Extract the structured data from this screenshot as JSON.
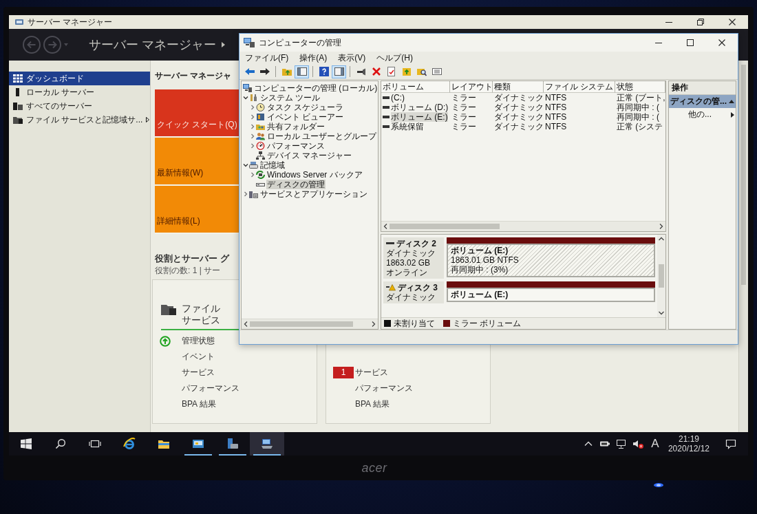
{
  "monitor": {
    "logo": "acer"
  },
  "server_manager": {
    "window_title": "サーバー マネージャー",
    "header_title": "サーバー マネージャー",
    "nav": [
      {
        "label": "ダッシュボード",
        "selected": true,
        "submenu": false
      },
      {
        "label": "ローカル サーバー",
        "selected": false,
        "submenu": false
      },
      {
        "label": "すべてのサーバー",
        "selected": false,
        "submenu": false
      },
      {
        "label": "ファイル サービスと記憶域サ...",
        "selected": false,
        "submenu": true
      }
    ],
    "heading": "サーバー マネージャ",
    "tiles": [
      {
        "label": "クイック スタート(Q)",
        "color": "#d8341c"
      },
      {
        "label": "最新情報(W)",
        "color": "#f28a06"
      },
      {
        "label": "詳細情報(L)",
        "color": "#f28a06"
      }
    ],
    "roles_heading": "役割とサーバー グ",
    "roles_count": "役割の数: 1 | サー",
    "cards": [
      {
        "title": [
          "ファイル",
          "サービス"
        ],
        "rows": [
          {
            "label": "管理状態",
            "kind": "status"
          },
          {
            "label": "イベント",
            "kind": "plain"
          },
          {
            "label": "サービス",
            "kind": "plain"
          },
          {
            "label": "パフォーマンス",
            "kind": "plain"
          },
          {
            "label": "BPA 結果",
            "kind": "plain"
          }
        ]
      },
      {
        "rows": [
          {
            "label": "サービス",
            "kind": "badge",
            "badge": "1"
          },
          {
            "label": "パフォーマンス",
            "kind": "plain"
          },
          {
            "label": "BPA 結果",
            "kind": "plain"
          }
        ]
      }
    ]
  },
  "computer_management": {
    "title": "コンピューターの管理",
    "menu": [
      "ファイル(F)",
      "操作(A)",
      "表示(V)",
      "ヘルプ(H)"
    ],
    "toolbar_groups": [
      {
        "buttons": [
          {
            "pressed": false
          },
          {
            "pressed": false
          }
        ]
      },
      {
        "buttons": [
          {
            "pressed": false
          },
          {
            "pressed": true
          }
        ]
      },
      {
        "buttons": [
          {
            "pressed": false
          },
          {
            "pressed": true
          }
        ]
      },
      {
        "buttons": [
          {
            "pressed": false
          },
          {
            "pressed": false
          },
          {
            "pressed": false
          },
          {
            "pressed": false
          },
          {
            "pressed": false
          },
          {
            "pressed": false
          }
        ]
      }
    ],
    "tree": [
      {
        "label": "コンピューターの管理 (ローカル)",
        "selected": false,
        "children": [
          {
            "label": "システム ツール",
            "expanded": true,
            "selected": false,
            "children": [
              {
                "label": "タスク スケジューラ",
                "expanded": false,
                "selected": false
              },
              {
                "label": "イベント ビューアー",
                "expanded": false,
                "selected": false
              },
              {
                "label": "共有フォルダー",
                "expanded": false,
                "selected": false
              },
              {
                "label": "ローカル ユーザーとグループ",
                "expanded": false,
                "selected": false
              },
              {
                "label": "パフォーマンス",
                "expanded": false,
                "selected": false
              },
              {
                "label": "デバイス マネージャー",
                "selected": false
              }
            ]
          },
          {
            "label": "記憶域",
            "expanded": true,
            "selected": false,
            "children": [
              {
                "label": "Windows Server バックア",
                "expanded": false,
                "selected": false
              },
              {
                "label": "ディスクの管理",
                "selected": true
              }
            ]
          },
          {
            "label": "サービスとアプリケーション",
            "expanded": false,
            "selected": false
          }
        ]
      }
    ],
    "volumes": {
      "columns": [
        "ボリューム",
        "レイアウト",
        "種類",
        "ファイル システム",
        "状態"
      ],
      "rows": [
        {
          "cells": [
            "(C:)",
            "ミラー",
            "ダイナミック",
            "NTFS",
            "正常 (ブート,"
          ],
          "selected": false
        },
        {
          "cells": [
            "ボリューム (D:)",
            "ミラー",
            "ダイナミック",
            "NTFS",
            "再同期中 : ("
          ],
          "selected": false
        },
        {
          "cells": [
            "ボリューム (E:)",
            "ミラー",
            "ダイナミック",
            "NTFS",
            "再同期中 : ("
          ],
          "selected": true
        },
        {
          "cells": [
            "系統保留",
            "ミラー",
            "ダイナミック",
            "NTFS",
            "正常 (システ"
          ],
          "selected": false
        }
      ]
    },
    "disks": [
      {
        "name": "ディスク 2",
        "warning": false,
        "details": [
          "ダイナミック",
          "1863.02 GB",
          "オンライン"
        ],
        "partitions": [
          {
            "name": "ボリューム (E:)",
            "details": [
              "1863.01 GB NTFS",
              "再同期中 : (3%)"
            ],
            "selected": true,
            "color": "#6a0d0d"
          }
        ]
      },
      {
        "name": "ディスク 3",
        "warning": true,
        "details": [
          "ダイナミック"
        ],
        "partitions": [
          {
            "name": "ボリューム (E:)",
            "selected": false,
            "color": "#6a0d0d"
          }
        ]
      }
    ],
    "legend": [
      {
        "label": "未割り当て",
        "color": "#111111"
      },
      {
        "label": "ミラー ボリューム",
        "color": "#6a0d0d"
      }
    ],
    "actions": {
      "header": "操作",
      "items": [
        {
          "label": "ディスクの管...",
          "kind": "section",
          "expanded": true
        },
        {
          "label": "他の...",
          "kind": "submenu"
        }
      ]
    }
  },
  "taskbar": {
    "apps": [
      {
        "running": false,
        "active": false
      },
      {
        "running": false,
        "active": false
      },
      {
        "running": true,
        "active": false
      },
      {
        "running": true,
        "active": false
      },
      {
        "running": true,
        "active": true
      }
    ],
    "ime": "A",
    "time": "21:19",
    "date": "2020/12/12"
  }
}
